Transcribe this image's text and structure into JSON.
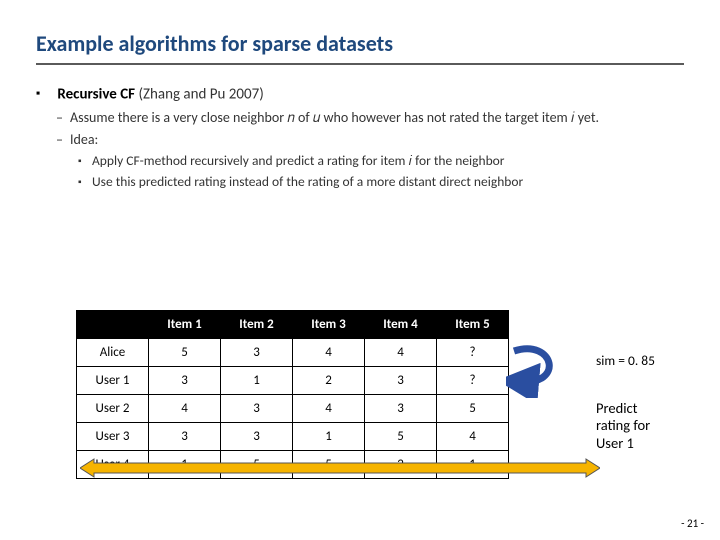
{
  "title": "Example algorithms for sparse datasets",
  "bullet": {
    "heading_bold": "Recursive CF",
    "heading_rest": " (Zhang and Pu 2007)",
    "sub1": "Assume there is a very close neighbor 𝑛 of 𝑢 who however has not rated the target item 𝑖 yet.",
    "sub2": "Idea:",
    "sub2a": "Apply CF-method recursively and predict a rating for item 𝑖 for the neighbor",
    "sub2b": "Use this predicted rating instead of the rating of a more distant direct neighbor"
  },
  "sim_text": "sim = 0. 85",
  "predict_text_l1": "Predict",
  "predict_text_l2": "rating for",
  "predict_text_l3": "User 1",
  "page": "- 21 -",
  "chart_data": {
    "type": "table",
    "columns": [
      "Item 1",
      "Item 2",
      "Item 3",
      "Item 4",
      "Item 5"
    ],
    "rows": [
      {
        "label": "Alice",
        "cells": [
          "5",
          "3",
          "4",
          "4",
          "?"
        ]
      },
      {
        "label": "User 1",
        "cells": [
          "3",
          "1",
          "2",
          "3",
          "?"
        ]
      },
      {
        "label": "User 2",
        "cells": [
          "4",
          "3",
          "4",
          "3",
          "5"
        ]
      },
      {
        "label": "User 3",
        "cells": [
          "3",
          "3",
          "1",
          "5",
          "4"
        ]
      },
      {
        "label": "User 4",
        "cells": [
          "1",
          "5",
          "5",
          "2",
          "1"
        ]
      }
    ]
  }
}
